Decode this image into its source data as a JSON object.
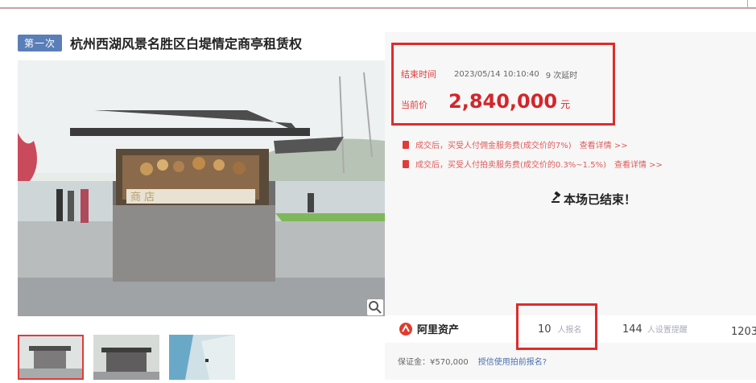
{
  "header": {
    "round_badge": "第一次",
    "title": "杭州西湖风景名胜区白堤情定商亭租赁权"
  },
  "auction": {
    "end_time_label": "结束时间",
    "end_time_value": "2023/05/14 10:10:40",
    "delay_count": "9 次延时",
    "price_label": "当前价",
    "price_value": "2,840,000",
    "price_unit": "元",
    "notices": [
      {
        "text": "成交后，买受人付佣金服务费(成交价的7%)",
        "more": "查看详情 >>"
      },
      {
        "text": "成交后，买受人付拍卖服务费(成交价的0.3%~1.5%)",
        "more": "查看详情 >>"
      }
    ],
    "ended_text": "本场已结束！"
  },
  "stats": {
    "brand": "阿里资产",
    "bidders_count": "10",
    "bidders_label": "人报名",
    "watchers_count": "144",
    "watchers_label": "人设置提醒",
    "views_count": "1203"
  },
  "deposit": {
    "label": "保证金：¥570,000",
    "link": "授信使用拍前报名?"
  },
  "colors": {
    "accent_red": "#e02b2b",
    "price_red": "#d4252b",
    "badge_blue": "#5a7fb8"
  }
}
